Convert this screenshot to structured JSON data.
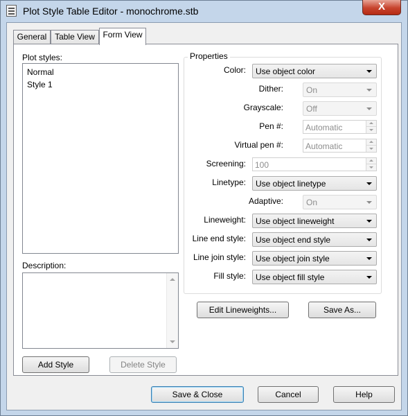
{
  "window": {
    "title": "Plot Style Table Editor - monochrome.stb",
    "close_glyph": "X"
  },
  "tabs": [
    {
      "label": "General",
      "active": false
    },
    {
      "label": "Table View",
      "active": false
    },
    {
      "label": "Form View",
      "active": true
    }
  ],
  "plot_styles": {
    "label": "Plot styles:",
    "items": [
      "Normal",
      "Style 1"
    ]
  },
  "description": {
    "label": "Description:",
    "value": ""
  },
  "left_buttons": {
    "add_style": "Add Style",
    "delete_style": "Delete Style"
  },
  "properties": {
    "title": "Properties",
    "color": {
      "label": "Color:",
      "value": "Use object color"
    },
    "dither": {
      "label": "Dither:",
      "value": "On"
    },
    "grayscale": {
      "label": "Grayscale:",
      "value": "Off"
    },
    "pen": {
      "label": "Pen #:",
      "value": "Automatic"
    },
    "virtual_pen": {
      "label": "Virtual pen #:",
      "value": "Automatic"
    },
    "screening": {
      "label": "Screening:",
      "value": "100"
    },
    "linetype": {
      "label": "Linetype:",
      "value": "Use object linetype"
    },
    "adaptive": {
      "label": "Adaptive:",
      "value": "On"
    },
    "lineweight": {
      "label": "Lineweight:",
      "value": "Use object lineweight"
    },
    "line_end": {
      "label": "Line end style:",
      "value": "Use object end style"
    },
    "line_join": {
      "label": "Line join style:",
      "value": "Use object join style"
    },
    "fill": {
      "label": "Fill style:",
      "value": "Use object fill style"
    }
  },
  "right_buttons": {
    "edit_lineweights": "Edit Lineweights...",
    "save_as": "Save As..."
  },
  "footer": {
    "save_close": "Save & Close",
    "cancel": "Cancel",
    "help": "Help"
  }
}
